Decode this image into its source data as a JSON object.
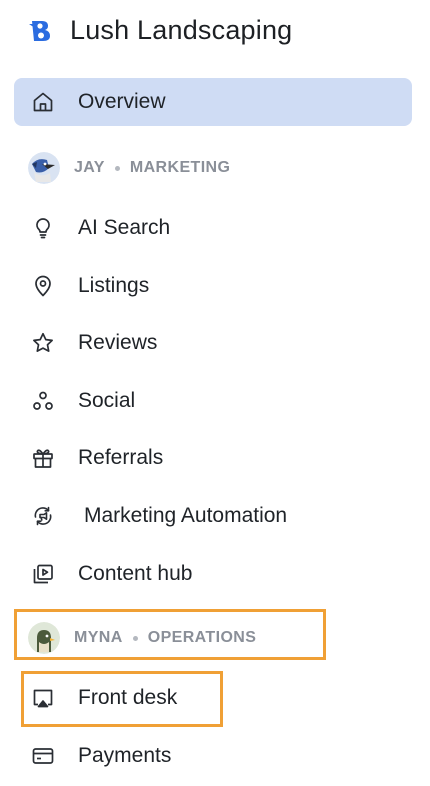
{
  "brand": {
    "name": "Lush Landscaping",
    "accent": "#2563eb"
  },
  "nav": {
    "overview": {
      "label": "Overview",
      "icon": "home-icon",
      "active": true
    },
    "marketing_section": {
      "person": "JAY",
      "team": "MARKETING"
    },
    "marketing_items": [
      {
        "label": "AI Search",
        "icon": "lightbulb-icon"
      },
      {
        "label": "Listings",
        "icon": "map-pin-icon"
      },
      {
        "label": "Reviews",
        "icon": "star-icon"
      },
      {
        "label": "Social",
        "icon": "social-dots-icon"
      },
      {
        "label": "Referrals",
        "icon": "gift-icon"
      },
      {
        "label": "Marketing Automation",
        "icon": "automation-icon"
      },
      {
        "label": "Content hub",
        "icon": "content-hub-icon"
      }
    ],
    "operations_section": {
      "person": "MYNA",
      "team": "OPERATIONS"
    },
    "operations_items": [
      {
        "label": "Front desk",
        "icon": "front-desk-icon"
      },
      {
        "label": "Payments",
        "icon": "card-icon"
      }
    ]
  },
  "colors": {
    "active_bg": "#cfdcf4",
    "highlight": "#f0a035",
    "section_text": "#8a8f98"
  }
}
